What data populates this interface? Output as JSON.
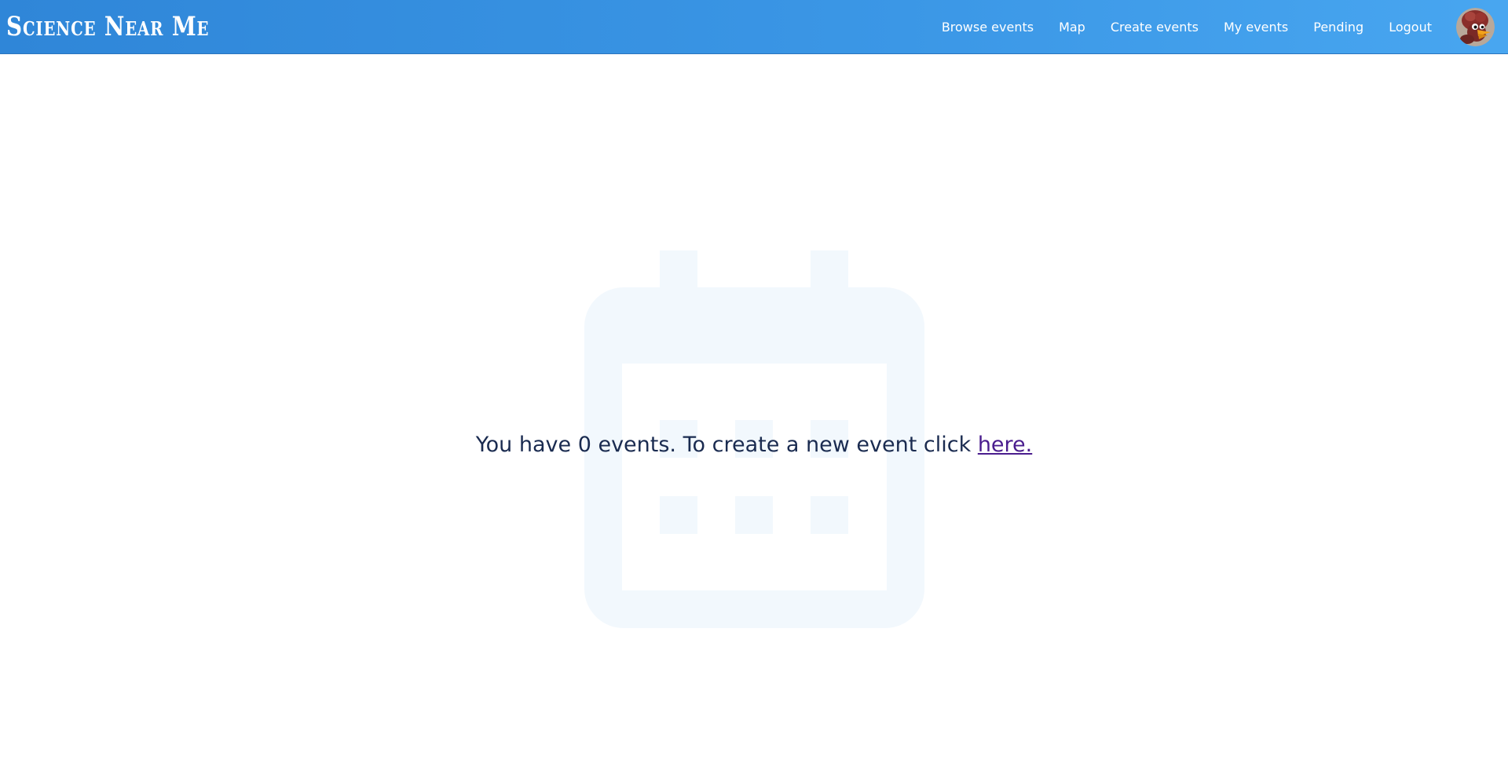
{
  "brand": {
    "name": "Science Near Me"
  },
  "nav": {
    "items": [
      {
        "label": "Browse events"
      },
      {
        "label": "Map"
      },
      {
        "label": "Create events"
      },
      {
        "label": "My events"
      },
      {
        "label": "Pending"
      },
      {
        "label": "Logout"
      }
    ]
  },
  "user": {
    "avatar_icon": "user-avatar-bird"
  },
  "empty_state": {
    "icon": "calendar-icon",
    "message": "You have 0 events. To create a new event click ",
    "link_text": "here."
  },
  "colors": {
    "header_blue": "#3590e0",
    "message_text": "#1a2b50",
    "link_visited": "#4a1d8e",
    "calendar_watermark": "#f2f8fd"
  }
}
